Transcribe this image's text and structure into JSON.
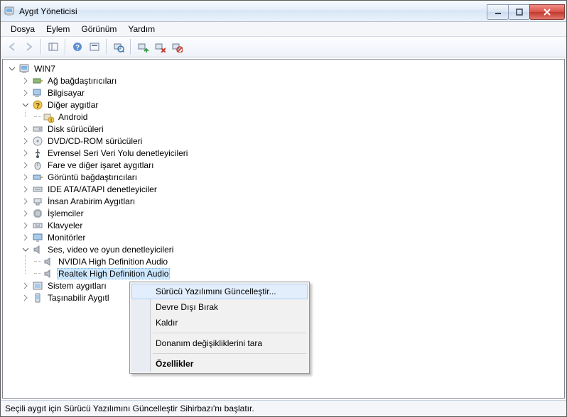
{
  "title": "Aygıt Yöneticisi",
  "menus": {
    "file": "Dosya",
    "action": "Eylem",
    "view": "Görünüm",
    "help": "Yardım"
  },
  "tree": {
    "root": "WIN7",
    "net": "Ağ bağdaştırıcıları",
    "computer": "Bilgisayar",
    "other": "Diğer aygıtlar",
    "android": "Android",
    "disk": "Disk sürücüleri",
    "dvd": "DVD/CD-ROM sürücüleri",
    "usb": "Evrensel Seri Veri Yolu denetleyicileri",
    "mice": "Fare ve diğer işaret aygıtları",
    "display": "Görüntü bağdaştırıcıları",
    "ide": "IDE ATA/ATAPI denetleyiciler",
    "hid": "İnsan Arabirim Aygıtları",
    "cpu": "İşlemciler",
    "keyboard": "Klavyeler",
    "monitor": "Monitörler",
    "sound": "Ses, video ve oyun denetleyicileri",
    "nvidia_audio": "NVIDIA High Definition Audio",
    "realtek_audio": "Realtek High Definition Audio",
    "system": "Sistem aygıtları",
    "portable": "Taşınabilir Aygıtl"
  },
  "context_menu": {
    "update": "Sürücü Yazılımını Güncelleştir...",
    "disable": "Devre Dışı Bırak",
    "uninstall": "Kaldır",
    "scan": "Donanım değişikliklerini tara",
    "properties": "Özellikler"
  },
  "status_text": "Seçili aygıt için Sürücü Yazılımını Güncelleştir Sihirbazı'nı başlatır."
}
